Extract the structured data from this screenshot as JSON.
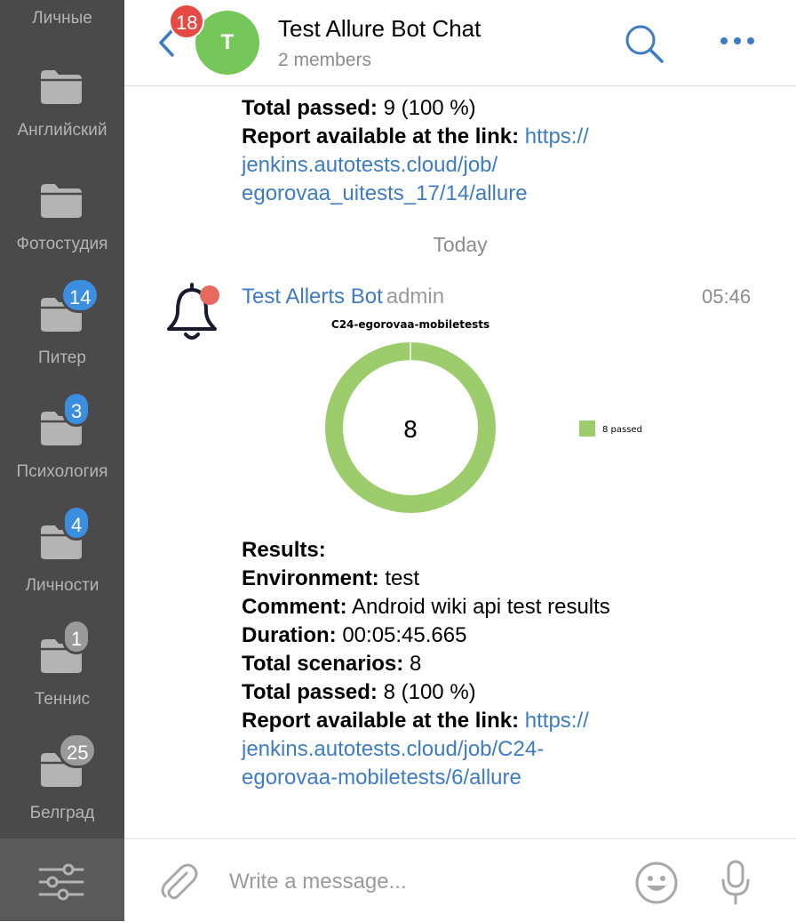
{
  "sidebar": {
    "top_label": "Личные",
    "folders": [
      {
        "label": "Английский",
        "badge": ""
      },
      {
        "label": "Фотостудия",
        "badge": ""
      },
      {
        "label": "Питер",
        "badge": "14"
      },
      {
        "label": "Психология",
        "badge": "3"
      },
      {
        "label": "Личности",
        "badge": "4"
      },
      {
        "label": "Теннис",
        "badge": "1"
      },
      {
        "label": "Белград",
        "badge": "25"
      }
    ],
    "icons": {
      "folder": "folder-icon",
      "settings": "sliders-icon"
    }
  },
  "header": {
    "back_badge": "18",
    "avatar_letter": "T",
    "title": "Test Allure Bot Chat",
    "subtitle": "2 members",
    "icons": {
      "back": "chevron-left-icon",
      "search": "search-icon",
      "more": "more-dots-icon"
    }
  },
  "colors": {
    "accent": "#3d7cc4",
    "badge_red": "#e64a45",
    "badge_blue": "#3b8ee0",
    "badge_gray": "#9a9a9a",
    "avatar_green": "#75c75a",
    "chart_green": "#9ccc6c",
    "sidebar_bg": "#4a4a4a"
  },
  "prev_message": {
    "total_passed_label": "Total passed:",
    "total_passed_value": "9 (100 %)",
    "report_label": "Report available at the link:",
    "link_1": "https://",
    "link_2": "jenkins.autotests.cloud/job/",
    "link_3": "egorovaa_uitests_17/14/allure"
  },
  "date_separator": "Today",
  "message": {
    "sender": "Test Allerts Bot",
    "role": "admin",
    "time": "05:46",
    "avatar_icon": "bell-icon",
    "results_label": "Results:",
    "environment_label": "Environment:",
    "environment_value": "test",
    "comment_label": "Comment:",
    "comment_value": "Android wiki api test results",
    "duration_label": "Duration:",
    "duration_value": "00:05:45.665",
    "scenarios_label": "Total scenarios:",
    "scenarios_value": "8",
    "passed_label": "Total passed:",
    "passed_value": "8 (100 %)",
    "report_label": "Report available at the link:",
    "link_1": "https://",
    "link_2": "jenkins.autotests.cloud/job/C24-",
    "link_3": "egorovaa-mobiletests/6/allure"
  },
  "chart_data": {
    "type": "pie",
    "title": "C24-egorovaa-mobiletests",
    "center_label": "8",
    "series": [
      {
        "name": "8 passed",
        "values": [
          8
        ]
      }
    ],
    "categories": [
      "passed"
    ],
    "legend": "right"
  },
  "composer": {
    "placeholder": "Write a message...",
    "icons": {
      "attach": "paperclip-icon",
      "emoji": "emoji-icon",
      "mic": "microphone-icon"
    }
  }
}
